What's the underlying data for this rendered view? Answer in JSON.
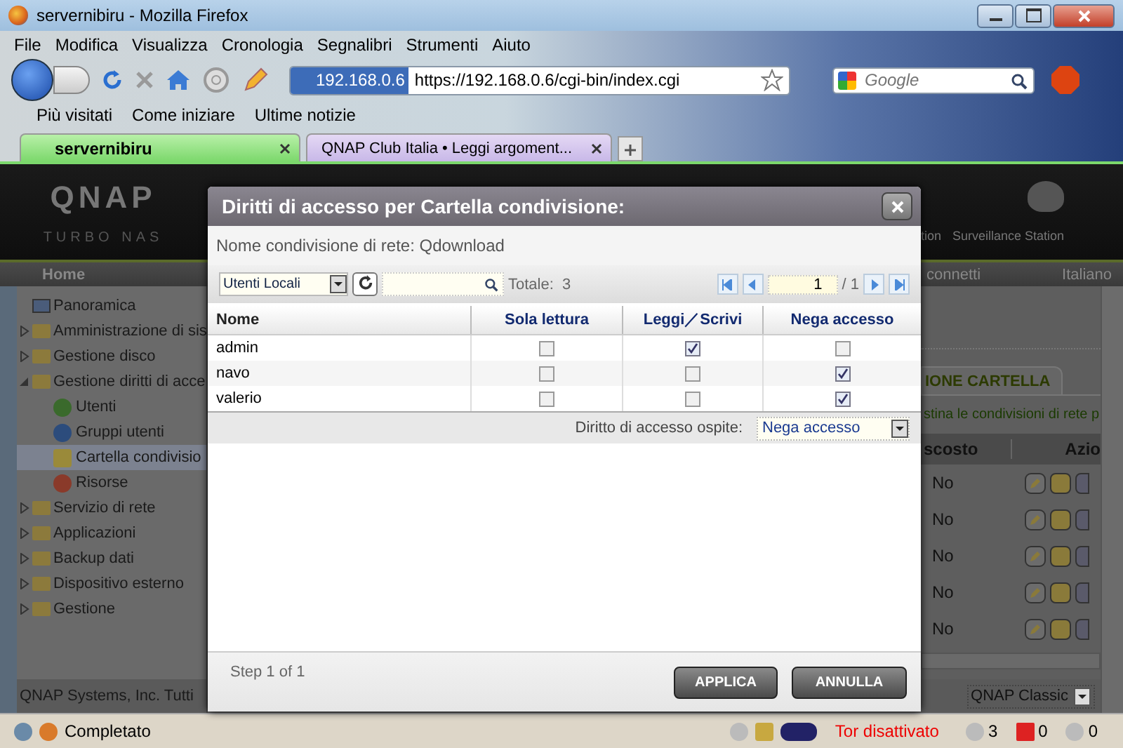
{
  "window": {
    "title": "servernibiru - Mozilla Firefox"
  },
  "menu": [
    "File",
    "Modifica",
    "Visualizza",
    "Cronologia",
    "Segnalibri",
    "Strumenti",
    "Aiuto"
  ],
  "address_bar": {
    "site": "192.168.0.6",
    "url": "https://192.168.0.6/cgi-bin/index.cgi"
  },
  "search": {
    "placeholder": "Google"
  },
  "bookmarks": [
    "Più visitati",
    "Come iniziare",
    "Ultime notizie"
  ],
  "tabs": [
    {
      "label": "servernibiru",
      "selected": true
    },
    {
      "label": "QNAP Club Italia • Leggi argoment...",
      "selected": false
    }
  ],
  "page": {
    "logo": "QNAP",
    "logo_sub": "TURBO NAS",
    "header_apps": [
      "tion",
      "Surveillance Station"
    ],
    "nav": {
      "home": "Home",
      "logout": "connetti",
      "language": "Italiano"
    },
    "sidebar": [
      {
        "label": "Panoramica",
        "kind": "page"
      },
      {
        "label": "Amministrazione di sis",
        "kind": "folder",
        "expanded": false
      },
      {
        "label": "Gestione disco",
        "kind": "folder",
        "expanded": false
      },
      {
        "label": "Gestione diritti di acce",
        "kind": "folder",
        "expanded": true,
        "children": [
          {
            "label": "Utenti",
            "kind": "user",
            "selected": false
          },
          {
            "label": "Gruppi utenti",
            "kind": "group",
            "selected": false
          },
          {
            "label": "Cartella condivisio",
            "kind": "share",
            "selected": true
          },
          {
            "label": "Risorse",
            "kind": "quota",
            "selected": false
          }
        ]
      },
      {
        "label": "Servizio di rete",
        "kind": "folder",
        "expanded": false
      },
      {
        "label": "Applicazioni",
        "kind": "folder",
        "expanded": false
      },
      {
        "label": "Backup dati",
        "kind": "folder",
        "expanded": false
      },
      {
        "label": "Dispositivo esterno",
        "kind": "folder",
        "expanded": false
      },
      {
        "label": "Gestione",
        "kind": "folder",
        "expanded": false
      }
    ],
    "content": {
      "tab": "IONE CARTELLA",
      "description": "stina le condivisioni di rete p",
      "columns": [
        "scosto",
        "Azio"
      ],
      "rows": [
        "No",
        "No",
        "No",
        "No",
        "No"
      ]
    },
    "footer": "QNAP Systems, Inc. Tutti",
    "theme": "QNAP Classic"
  },
  "dialog": {
    "title": "Diritti di accesso per Cartella condivisione:",
    "share": "Nome condivisione di rete: Qdownload",
    "filter": "Utenti Locali",
    "total": "Totale:  3",
    "page": "1",
    "pages": "/ 1",
    "columns": [
      "Nome",
      "Sola lettura",
      "Leggi／Scrivi",
      "Nega accesso"
    ],
    "rows": [
      {
        "name": "admin",
        "read_only": false,
        "read_write": true,
        "deny": false
      },
      {
        "name": "navo",
        "read_only": false,
        "read_write": false,
        "deny": true
      },
      {
        "name": "valerio",
        "read_only": false,
        "read_write": false,
        "deny": true
      }
    ],
    "guest_label": "Diritto di accesso ospite:",
    "guest_value": "Nega accesso",
    "step": "Step 1 of 1",
    "buttons": [
      "APPLICA",
      "ANNULLA"
    ]
  },
  "status_bar": {
    "text": "Completato",
    "tor": "Tor disattivato",
    "counts": [
      "3",
      "0",
      "0"
    ]
  }
}
